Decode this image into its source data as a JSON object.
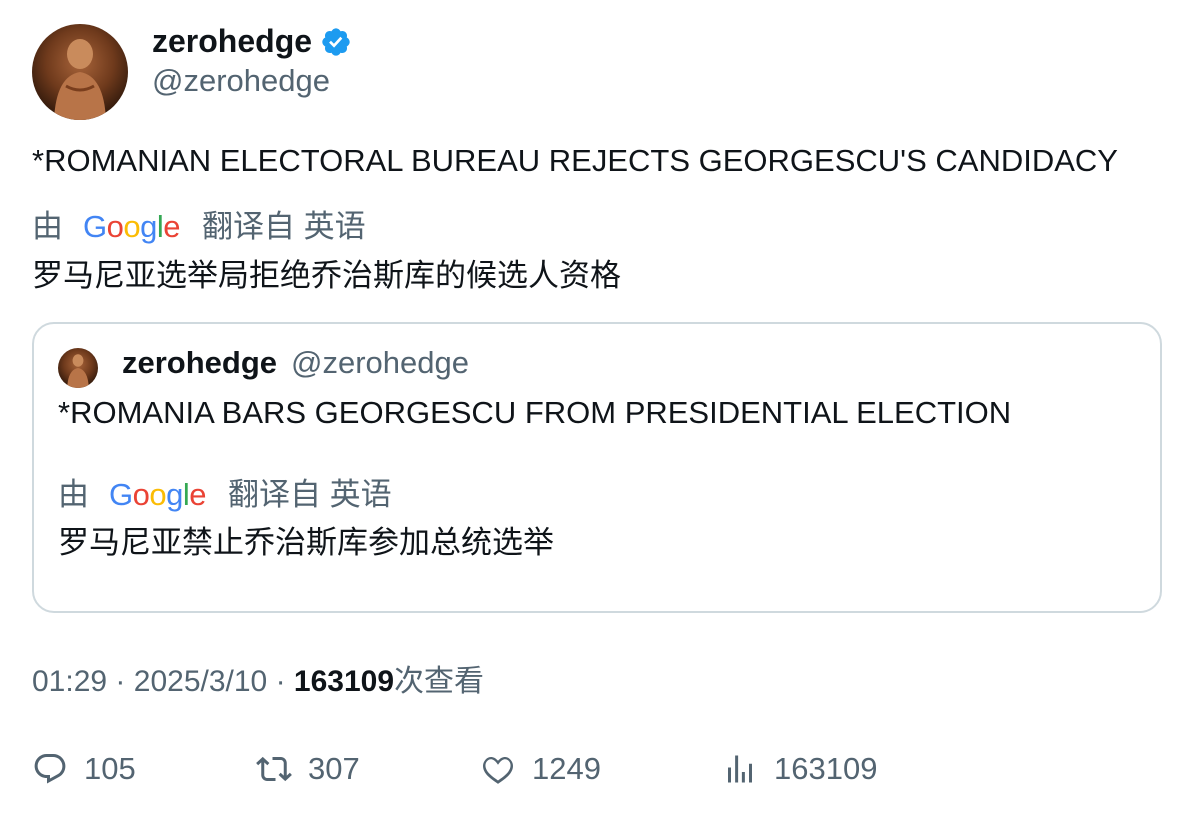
{
  "author": {
    "name": "zerohedge",
    "handle": "@zerohedge",
    "verified": true
  },
  "tweet": {
    "text": "*ROMANIAN ELECTORAL BUREAU REJECTS GEORGESCU'S CANDIDACY",
    "translation": {
      "prefix": "由",
      "provider": "Google",
      "suffix": "翻译自 英语",
      "text": "罗马尼亚选举局拒绝乔治斯库的候选人资格"
    }
  },
  "quoted": {
    "name": "zerohedge",
    "handle": "@zerohedge",
    "text": "*ROMANIA BARS GEORGESCU FROM PRESIDENTIAL ELECTION",
    "translation": {
      "prefix": "由",
      "provider": "Google",
      "suffix": "翻译自 英语",
      "text": "罗马尼亚禁止乔治斯库参加总统选举"
    }
  },
  "meta": {
    "time": "01:29",
    "sep": "·",
    "date": "2025/3/10",
    "views": "163109",
    "views_label": "次查看"
  },
  "actions": {
    "replies": "105",
    "retweets": "307",
    "likes": "1249",
    "views": "163109"
  },
  "colors": {
    "text": "#0f1419",
    "secondary": "#536471",
    "verified": "#1d9bf0",
    "border": "#cfd9de"
  }
}
